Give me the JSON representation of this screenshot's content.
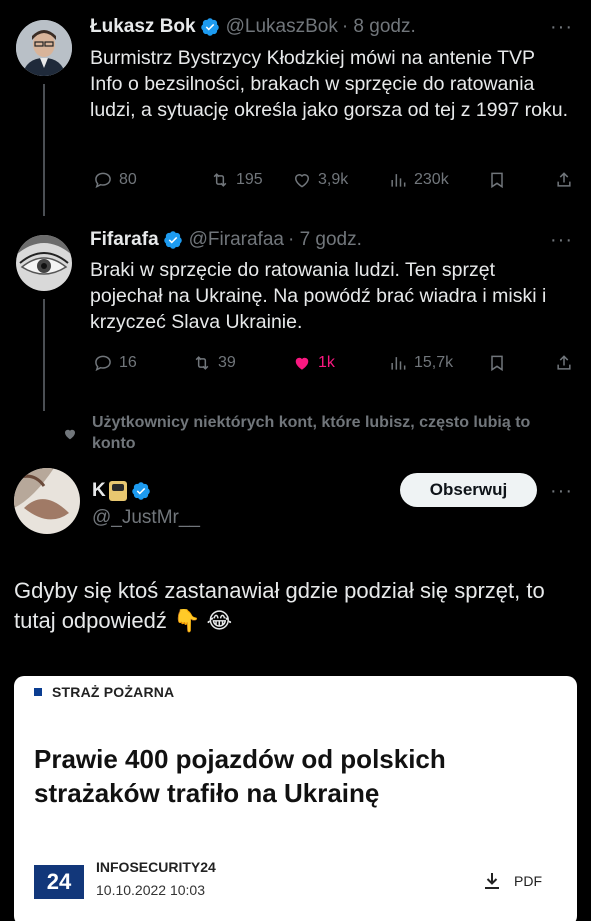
{
  "tweets": [
    {
      "name": "Łukasz Bok",
      "handle": "@LukaszBok",
      "time": "· 8 godz.",
      "text": "Burmistrz Bystrzycy Kłodzkiej mówi na antenie TVP Info o bezsilności, brakach w sprzęcie do ratowania ludzi, a sytuację określa jako gorsza od tej z 1997 roku.",
      "replies": "80",
      "retweets": "195",
      "likes": "3,9k",
      "views": "230k"
    },
    {
      "name": "Fifarafa",
      "handle": "@Firarafaa",
      "time": "· 7 godz.",
      "text": "Braki w sprzęcie do ratowania ludzi. Ten sprzęt pojechał na Ukrainę. Na powódź brać wiadra i miski i krzyczeć Slava Ukrainie.",
      "replies": "16",
      "retweets": "39",
      "likes": "1k",
      "views": "15,7k"
    }
  ],
  "social_context": "Użytkownicy niektórych kont, które lubisz, często lubią to konto",
  "post": {
    "name": "K",
    "handle": "@_JustMr__",
    "follow_label": "Obserwuj",
    "text": "Gdyby się ktoś zastanawiał gdzie podział się sprzęt, to tutaj odpowiedź 👇 😂"
  },
  "card": {
    "category": "STRAŻ POŻARNA",
    "headline": "Prawie 400 pojazdów od polskich strażaków trafiło na Ukrainę",
    "source_logo": "24",
    "source_name": "INFOSECURITY24",
    "date": "10.10.2022 10:03",
    "pdf_label": "PDF"
  },
  "colors": {
    "background": "#000000",
    "muted": "#71767b",
    "like_active": "#f91880",
    "verified": "#1d9bf0",
    "card_accent": "#12377a"
  },
  "icons": [
    "verified-icon",
    "reply-icon",
    "retweet-icon",
    "heart-icon",
    "views-icon",
    "bookmark-icon",
    "share-icon",
    "more-icon",
    "download-icon"
  ]
}
